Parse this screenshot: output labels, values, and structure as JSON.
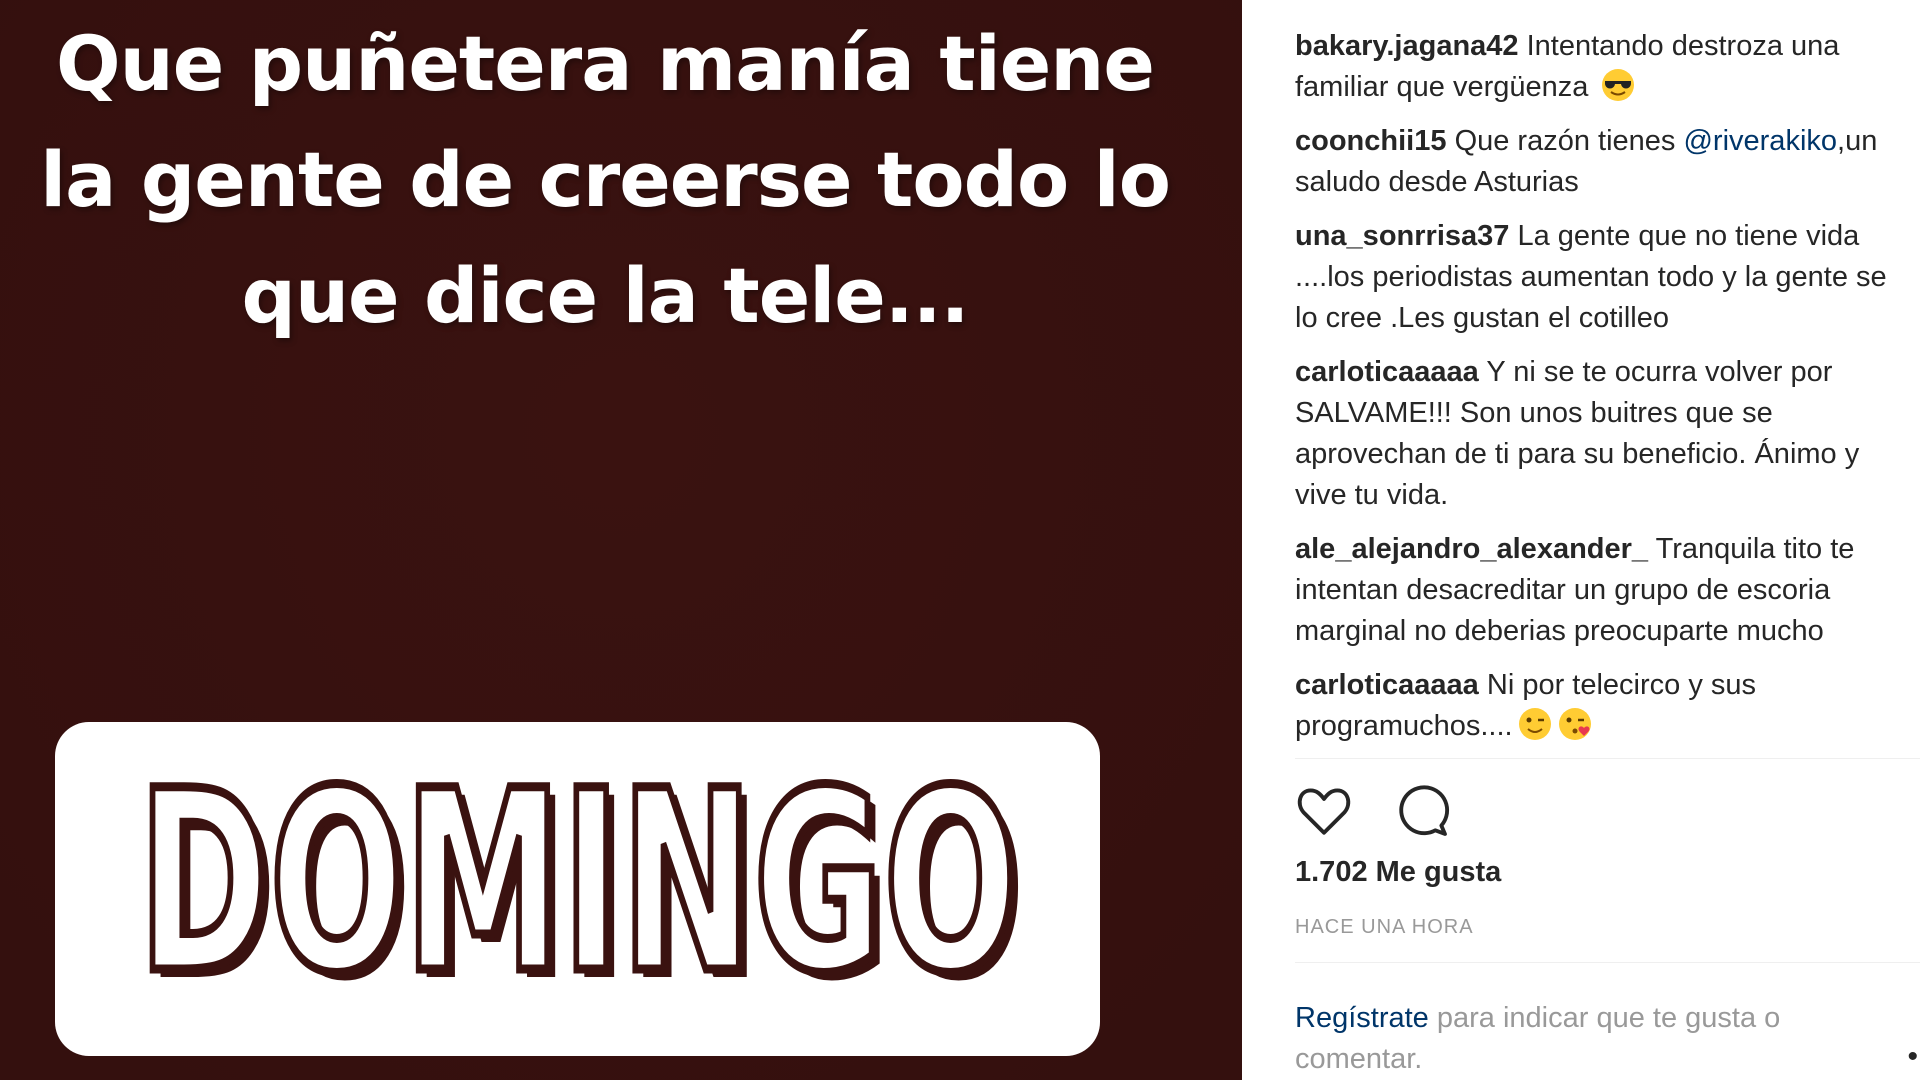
{
  "story": {
    "caption_lines": [
      "Que puñetera manía tiene",
      "la gente de creerse todo lo",
      "que dice la tele..."
    ],
    "sticker_text": "DOMINGO"
  },
  "comments": [
    {
      "user": "bakary.jagana42",
      "text": "Intentando destroza una familiar que vergüenza",
      "emoji": [
        "sunglasses-face"
      ]
    },
    {
      "user": "coonchii15",
      "text_before": "Que razón tienes ",
      "mention": "@riverakiko",
      "text_after": ",un saludo desde Asturias"
    },
    {
      "user": "una_sonrrisa37",
      "text": "La gente que no tiene vida ....los periodistas aumentan todo y la gente se lo cree .Les gustan el cotilleo"
    },
    {
      "user": "carloticaaaaa",
      "text": "Y ni se te ocurra volver por SALVAME!!! Son unos buitres que se aprovechan de ti para su beneficio. Ánimo y vive tu vida."
    },
    {
      "user": "ale_alejandro_alexander_",
      "text": "Tranquila tito te intentan desacreditar un grupo de escoria marginal no deberias preocuparte mucho"
    },
    {
      "user": "carloticaaaaa",
      "text": "Ni por telecirco y sus programuchos....",
      "emoji": [
        "winking-face",
        "kissing-face"
      ]
    }
  ],
  "likes": "1.702 Me gusta",
  "timestamp": "HACE UNA HORA",
  "login": {
    "link": "Regístrate",
    "text": " para indicar que te gusta o comentar."
  },
  "more": "•",
  "colors": {
    "story_bg": "#3a1210",
    "username": "#262626",
    "link": "#003569",
    "muted": "#999999"
  }
}
